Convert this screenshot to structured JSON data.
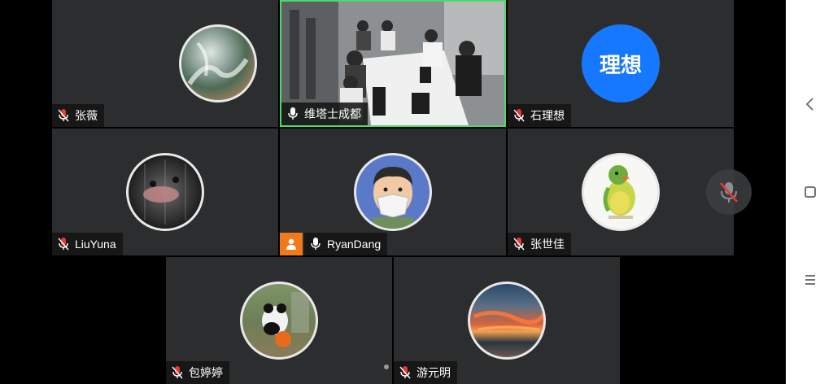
{
  "participants": [
    {
      "name": "张薇",
      "muted": true
    },
    {
      "name": "维塔士成都",
      "muted": false,
      "active_speaker": true
    },
    {
      "name": "石理想",
      "muted": true,
      "avatar_text": "理想"
    },
    {
      "name": "LiuYuna",
      "muted": true
    },
    {
      "name": "RyanDang",
      "muted": false,
      "host": true
    },
    {
      "name": "张世佳",
      "muted": true
    },
    {
      "name": "包婷婷",
      "muted": true
    },
    {
      "name": "游元明",
      "muted": true
    }
  ],
  "colors": {
    "tile_bg": "#2b2d2f",
    "active_border": "#4cd964",
    "muted_mic": "#e53935",
    "host_badge": "#f27a1a",
    "avatar_blue": "#1677ff"
  },
  "controls": {
    "floating_mic_icon": "mic-muted-icon",
    "nav_back_icon": "chevron-left-icon",
    "nav_home_icon": "square-icon",
    "nav_menu_icon": "menu-icon"
  }
}
